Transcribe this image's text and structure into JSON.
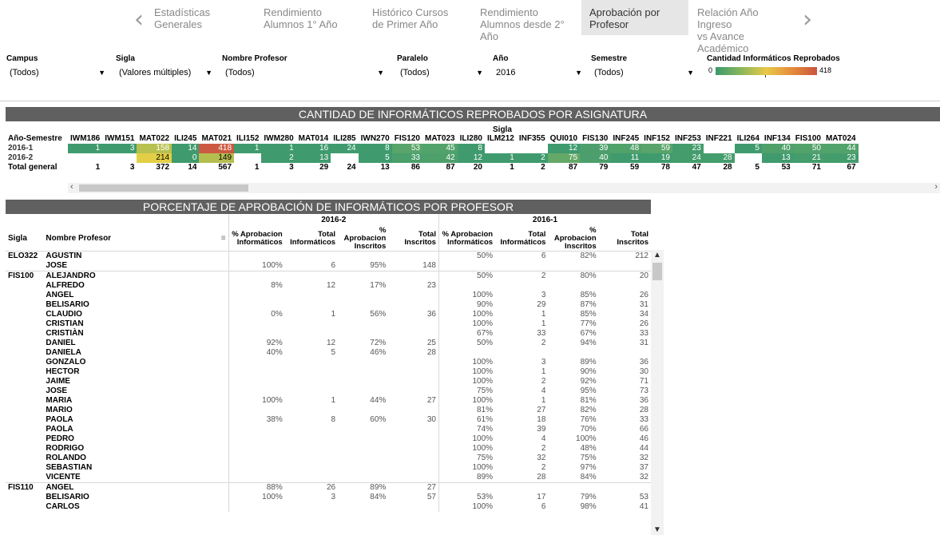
{
  "nav": {
    "tabs": [
      {
        "line1": "Estadísticas",
        "line2": "Generales"
      },
      {
        "line1": "Rendimiento",
        "line2": "Alumnos 1° Año"
      },
      {
        "line1": "Histórico Cursos",
        "line2": "de Primer Año"
      },
      {
        "line1": "Rendimiento",
        "line2": "Alumnos desde 2° Año"
      },
      {
        "line1": "Aprobación por",
        "line2": "Profesor"
      },
      {
        "line1": "Relación Año Ingreso",
        "line2": "vs Avance Académico"
      }
    ],
    "prev": "‹",
    "next": "›"
  },
  "filters": {
    "campus": {
      "label": "Campus",
      "value": "(Todos)"
    },
    "sigla": {
      "label": "Sigla",
      "value": "(Valores múltiples)"
    },
    "profesor": {
      "label": "Nombre Profesor",
      "value": "(Todos)"
    },
    "paralelo": {
      "label": "Paralelo",
      "value": "(Todos)"
    },
    "anio": {
      "label": "Año",
      "value": "2016"
    },
    "semestre": {
      "label": "Semestre",
      "value": "(Todos)"
    },
    "legend": {
      "label": "Cantidad Informáticos Reprobados",
      "min": "0",
      "max": "418"
    }
  },
  "reprobados": {
    "title": "CANTIDAD DE INFORMÁTICOS REPROBADOS POR ASIGNATURA",
    "sigla_label": "Sigla",
    "row_header": "Año-Semestre",
    "columns": [
      "IWM186",
      "IWM151",
      "MAT022",
      "ILI245",
      "MAT021",
      "ILI152",
      "IWM280",
      "MAT014",
      "ILI285",
      "IWN270",
      "FIS120",
      "MAT023",
      "ILI280",
      "ILM212",
      "INF355",
      "QUI010",
      "FIS130",
      "INF245",
      "INF152",
      "INF253",
      "INF221",
      "ILI264",
      "INF134",
      "FIS100",
      "MAT024"
    ],
    "rows": [
      {
        "label": "2016-1",
        "values": [
          "1",
          "3",
          "158",
          "14",
          "418",
          "1",
          "1",
          "16",
          "24",
          "8",
          "53",
          "45",
          "8",
          "",
          "",
          "12",
          "39",
          "48",
          "59",
          "23",
          "",
          "5",
          "40",
          "50",
          "44"
        ]
      },
      {
        "label": "2016-2",
        "values": [
          "",
          "",
          "214",
          "0",
          "149",
          "",
          "2",
          "13",
          "",
          "5",
          "33",
          "42",
          "12",
          "1",
          "2",
          "75",
          "40",
          "11",
          "19",
          "24",
          "28",
          "",
          "13",
          "21",
          "23"
        ]
      }
    ],
    "total": {
      "label": "Total general",
      "values": [
        "1",
        "3",
        "372",
        "14",
        "567",
        "1",
        "3",
        "29",
        "24",
        "13",
        "86",
        "87",
        "20",
        "1",
        "2",
        "87",
        "79",
        "59",
        "78",
        "47",
        "28",
        "5",
        "53",
        "71",
        "67"
      ]
    },
    "colors": {
      "2016-1": [
        "#3f9b6e",
        "#3f9b6e",
        "#b8c14f",
        "#3f9b6e",
        "#cc5a42",
        "#3f9b6e",
        "#3f9b6e",
        "#3f9b6e",
        "#3f9b6e",
        "#3f9b6e",
        "#58a46a",
        "#52a26b",
        "#3f9b6e",
        "",
        "",
        "#3f9b6e",
        "#4c9f6c",
        "#51a16b",
        "#58a46a",
        "#449c6d",
        "",
        "#3f9b6e",
        "#4fa06b",
        "#53a26b",
        "#52a26b"
      ],
      "2016-2": [
        "",
        "",
        "#e3cf45",
        "#3f9b6e",
        "#b4be4f",
        "",
        "#3f9b6e",
        "#3f9b6e",
        "",
        "#3f9b6e",
        "#4a9f6c",
        "#4ea06b",
        "#3f9b6e",
        "#3f9b6e",
        "#3f9b6e",
        "#65a968",
        "#4c9f6c",
        "#3f9b6e",
        "#3f9b6e",
        "#449c6d",
        "#459d6d",
        "",
        "#3f9b6e",
        "#459d6d",
        "#449c6d"
      ]
    }
  },
  "aprobacion": {
    "title": "PORCENTAJE DE APROBACIÓN DE INFORMÁTICOS POR PROFESOR",
    "period_a": "2016-2",
    "period_b": "2016-1",
    "col_sigla": "Sigla",
    "col_profesor": "Nombre Profesor",
    "sub": [
      "% Aprobacion Informáticos",
      "Total Informáticos",
      "% Aprobacion Inscritos",
      "Total Inscritos"
    ],
    "rows": [
      [
        "ELO322",
        "AGUSTIN",
        "",
        "",
        "",
        "",
        "50%",
        "6",
        "82%",
        "212"
      ],
      [
        "",
        "JOSE",
        "100%",
        "6",
        "95%",
        "148",
        "",
        "",
        "",
        ""
      ],
      [
        "FIS100",
        "ALEJANDRO",
        "",
        "",
        "",
        "",
        "50%",
        "2",
        "80%",
        "20"
      ],
      [
        "",
        "ALFREDO",
        "8%",
        "12",
        "17%",
        "23",
        "",
        "",
        "",
        ""
      ],
      [
        "",
        "ANGEL",
        "",
        "",
        "",
        "",
        "100%",
        "3",
        "85%",
        "26"
      ],
      [
        "",
        "BELISARIO",
        "",
        "",
        "",
        "",
        "90%",
        "29",
        "87%",
        "31"
      ],
      [
        "",
        "CLAUDIO",
        "0%",
        "1",
        "56%",
        "36",
        "100%",
        "1",
        "85%",
        "34"
      ],
      [
        "",
        "CRISTIAN",
        "",
        "",
        "",
        "",
        "100%",
        "1",
        "77%",
        "26"
      ],
      [
        "",
        "CRISTIÀN",
        "",
        "",
        "",
        "",
        "67%",
        "33",
        "67%",
        "33"
      ],
      [
        "",
        "DANIEL",
        "92%",
        "12",
        "72%",
        "25",
        "50%",
        "2",
        "94%",
        "31"
      ],
      [
        "",
        "DANIELA",
        "40%",
        "5",
        "46%",
        "28",
        "",
        "",
        "",
        ""
      ],
      [
        "",
        "GONZALO",
        "",
        "",
        "",
        "",
        "100%",
        "3",
        "89%",
        "36"
      ],
      [
        "",
        "HECTOR",
        "",
        "",
        "",
        "",
        "100%",
        "1",
        "90%",
        "30"
      ],
      [
        "",
        "JAIME",
        "",
        "",
        "",
        "",
        "100%",
        "2",
        "92%",
        "71"
      ],
      [
        "",
        "JOSE",
        "",
        "",
        "",
        "",
        "75%",
        "4",
        "95%",
        "73"
      ],
      [
        "",
        "MARIA",
        "100%",
        "1",
        "44%",
        "27",
        "100%",
        "1",
        "81%",
        "36"
      ],
      [
        "",
        "MARIO",
        "",
        "",
        "",
        "",
        "81%",
        "27",
        "82%",
        "28"
      ],
      [
        "",
        "PAOLA",
        "38%",
        "8",
        "60%",
        "30",
        "61%",
        "18",
        "76%",
        "33"
      ],
      [
        "",
        "PAOLA",
        "",
        "",
        "",
        "",
        "74%",
        "39",
        "70%",
        "66"
      ],
      [
        "",
        "PEDRO",
        "",
        "",
        "",
        "",
        "100%",
        "4",
        "100%",
        "46"
      ],
      [
        "",
        "RODRIGO",
        "",
        "",
        "",
        "",
        "100%",
        "2",
        "48%",
        "44"
      ],
      [
        "",
        "ROLANDO",
        "",
        "",
        "",
        "",
        "75%",
        "32",
        "75%",
        "32"
      ],
      [
        "",
        "SEBASTIAN",
        "",
        "",
        "",
        "",
        "100%",
        "2",
        "97%",
        "37"
      ],
      [
        "",
        "VICENTE",
        "",
        "",
        "",
        "",
        "89%",
        "28",
        "84%",
        "32"
      ],
      [
        "FIS110",
        "ANGEL",
        "88%",
        "26",
        "89%",
        "27",
        "",
        "",
        "",
        ""
      ],
      [
        "",
        "BELISARIO",
        "100%",
        "3",
        "84%",
        "57",
        "53%",
        "17",
        "79%",
        "53"
      ],
      [
        "",
        "CARLOS",
        "",
        "",
        "",
        "",
        "100%",
        "6",
        "98%",
        "41"
      ]
    ]
  }
}
